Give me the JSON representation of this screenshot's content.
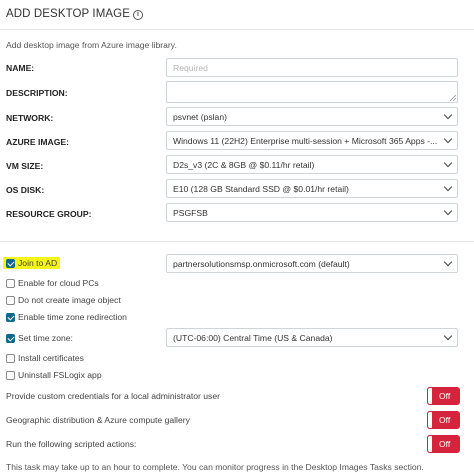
{
  "header": {
    "title": "ADD DESKTOP IMAGE",
    "info_icon": "i"
  },
  "subtitle": "Add desktop image from Azure image library.",
  "form": {
    "name": {
      "label": "NAME:",
      "value": "",
      "placeholder": "Required"
    },
    "description": {
      "label": "DESCRIPTION:",
      "value": ""
    },
    "network": {
      "label": "NETWORK:",
      "value": "psvnet (pslan)"
    },
    "azure_image": {
      "label": "AZURE IMAGE:",
      "value": "Windows 11 (22H2) Enterprise multi-session + Microsoft 365 Apps -..."
    },
    "vm_size": {
      "label": "VM SIZE:",
      "value": "D2s_v3 (2C & 8GB @ $0.11/hr retail)"
    },
    "os_disk": {
      "label": "OS DISK:",
      "value": "E10 (128 GB Standard SSD @ $0.01/hr retail)"
    },
    "resource_group": {
      "label": "RESOURCE GROUP:",
      "value": "PSGFSB"
    }
  },
  "options": {
    "join_ad": {
      "label": "Join to AD",
      "checked": true,
      "domain_value": "partnersolutionsmsp.onmicrosoft.com (default)"
    },
    "enable_cloud_pcs": {
      "label": "Enable for cloud PCs",
      "checked": false
    },
    "no_image_object": {
      "label": "Do not create image object",
      "checked": false
    },
    "time_zone_redirection": {
      "label": "Enable time zone redirection",
      "checked": true
    },
    "set_time_zone": {
      "label": "Set time zone:",
      "checked": true,
      "value": "(UTC-06:00) Central Time (US & Canada)"
    },
    "install_certificates": {
      "label": "Install certificates",
      "checked": false
    },
    "uninstall_fslogix": {
      "label": "Uninstall FSLogix app",
      "checked": false
    }
  },
  "toggles": [
    {
      "label": "Provide custom credentials for a local administrator user",
      "state": "Off"
    },
    {
      "label": "Geographic distribution & Azure compute gallery",
      "state": "Off"
    },
    {
      "label": "Run the following scripted actions:",
      "state": "Off"
    }
  ],
  "footnote": "This task may take up to an hour to complete. You can monitor progress in the Desktop Images Tasks section.",
  "colors": {
    "accent": "#0d6a8c",
    "toggle_off": "#d6233c",
    "highlight": "#f5f51a"
  }
}
